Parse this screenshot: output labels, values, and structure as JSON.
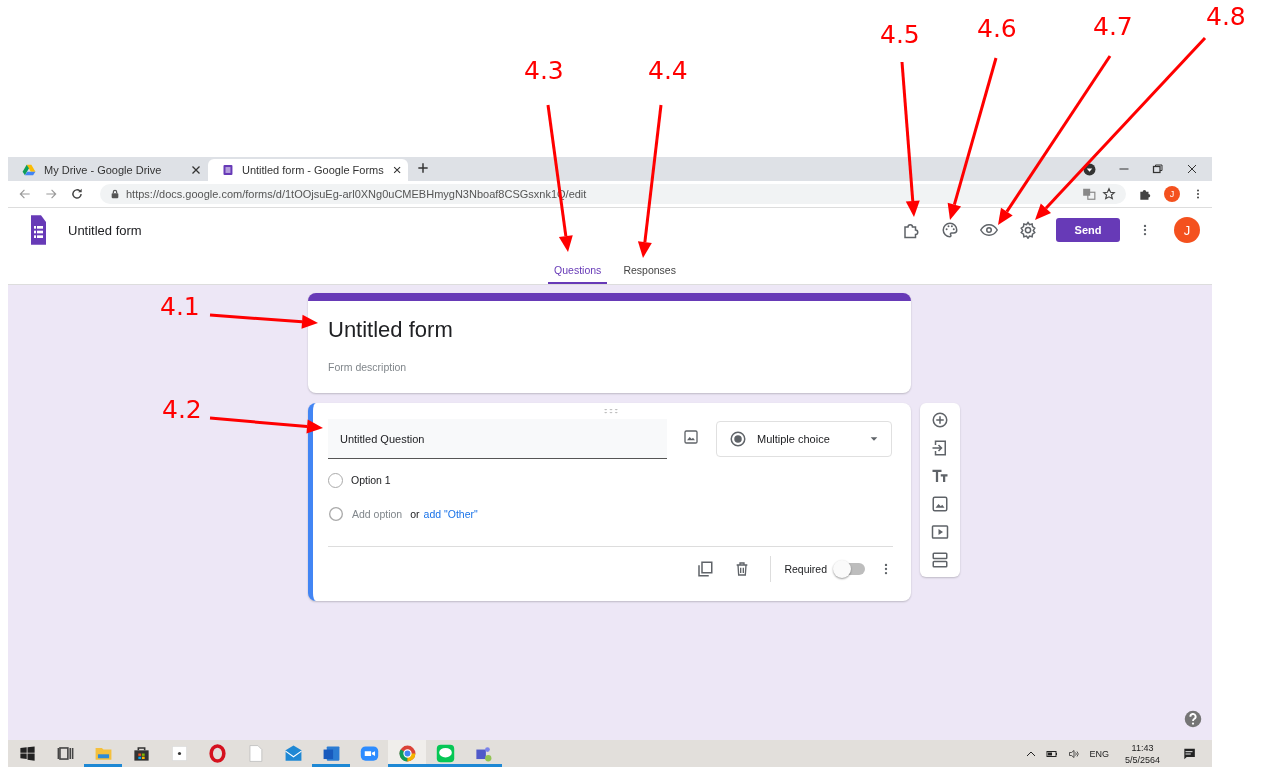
{
  "annotations": [
    {
      "label": "4.1"
    },
    {
      "label": "4.2"
    },
    {
      "label": "4.3"
    },
    {
      "label": "4.4"
    },
    {
      "label": "4.5"
    },
    {
      "label": "4.6"
    },
    {
      "label": "4.7"
    },
    {
      "label": "4.8"
    }
  ],
  "browser": {
    "tabs": [
      {
        "title": "My Drive - Google Drive",
        "selected": false
      },
      {
        "title": "Untitled form - Google Forms",
        "selected": true
      }
    ],
    "url": "https://docs.google.com/forms/d/1tOOjsuEg-arl0XNg0uCMEBHmygN3Nboaf8CSGsxnk1Q/edit",
    "profile_initial": "J"
  },
  "app": {
    "title": "Untitled form",
    "send_button": "Send",
    "avatar_initial": "J",
    "tabs": [
      {
        "label": "Questions",
        "selected": true
      },
      {
        "label": "Responses",
        "selected": false
      }
    ]
  },
  "form": {
    "title": "Untitled form",
    "description_placeholder": "Form description",
    "question": {
      "title": "Untitled Question",
      "type": "Multiple choice",
      "options": [
        {
          "label": "Option 1",
          "selected": false
        }
      ],
      "add_option": "Add option",
      "or": "or",
      "add_other": "add \"Other\"",
      "required_label": "Required",
      "required": false
    }
  },
  "taskbar": {
    "language": "ENG",
    "time": "11:43",
    "date": "5/5/2564"
  }
}
